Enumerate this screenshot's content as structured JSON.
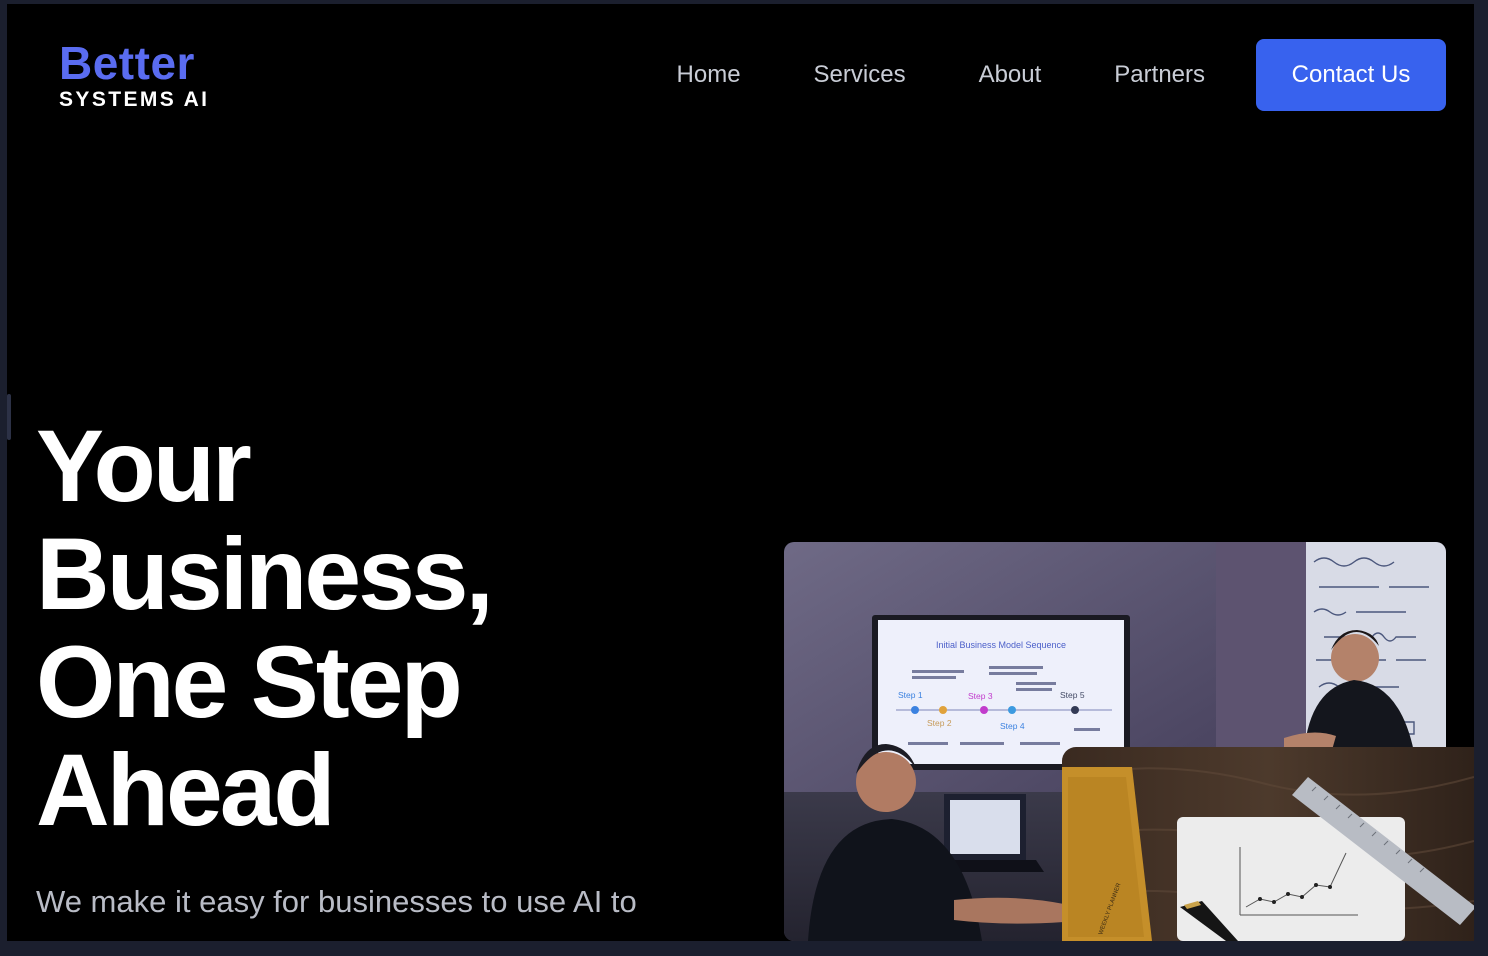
{
  "logo": {
    "line1": "Better",
    "line2": "SYSTEMS AI"
  },
  "nav": {
    "items": [
      {
        "label": "Home"
      },
      {
        "label": "Services"
      },
      {
        "label": "About"
      },
      {
        "label": "Partners"
      }
    ],
    "cta_label": "Contact Us"
  },
  "hero": {
    "title_lines": [
      "Your",
      "Business,",
      "One Step",
      "Ahead"
    ],
    "subtitle": "We make it easy for businesses to use AI to"
  },
  "images": {
    "main": {
      "screen_title": "Initial Business Model Sequence",
      "steps": [
        "Step 1",
        "Step 2",
        "Step 3",
        "Step 4",
        "Step 5"
      ]
    },
    "small": {
      "book_label": "WEEKLY PLANNER"
    }
  },
  "colors": {
    "brand": "#5a6cf0",
    "cta": "#3862ee",
    "background": "#000000"
  }
}
